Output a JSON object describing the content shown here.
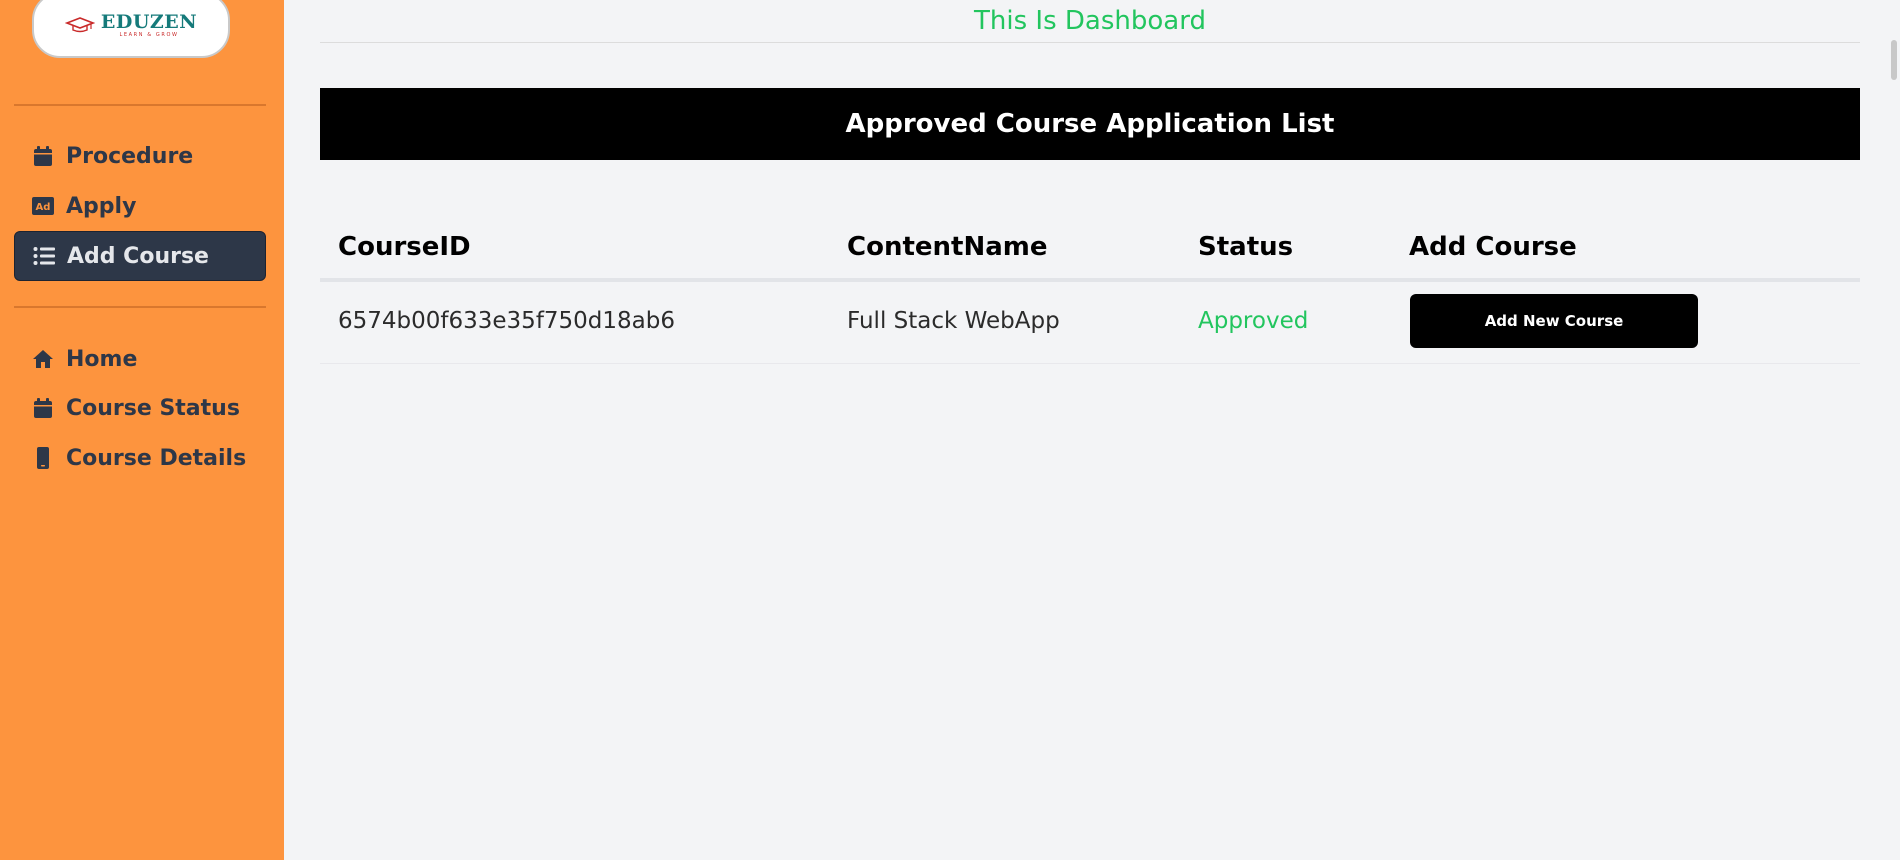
{
  "brand": {
    "name": "EDUZEN",
    "tagline": "LEARN & GROW"
  },
  "sidebar": {
    "items_top": [
      {
        "label": "Procedure",
        "icon": "calendar-icon",
        "active": false
      },
      {
        "label": "Apply",
        "icon": "ad-icon",
        "active": false
      },
      {
        "label": "Add Course",
        "icon": "list-icon",
        "active": true
      }
    ],
    "items_bottom": [
      {
        "label": "Home",
        "icon": "home-icon",
        "active": false
      },
      {
        "label": "Course Status",
        "icon": "calendar-icon",
        "active": false
      },
      {
        "label": "Course Details",
        "icon": "mobile-icon",
        "active": false
      }
    ]
  },
  "main": {
    "page_title": "This Is Dashboard",
    "banner_title": "Approved Course Application List",
    "table": {
      "headers": [
        "CourseID",
        "ContentName",
        "Status",
        "Add Course"
      ],
      "rows": [
        {
          "course_id": "6574b00f633e35f750d18ab6",
          "content_name": "Full Stack WebApp",
          "status": "Approved",
          "action_label": "Add New Course"
        }
      ]
    }
  },
  "colors": {
    "sidebar_bg": "#fd943e",
    "active_item_bg": "#2d3748",
    "accent_green": "#22c55e",
    "banner_bg": "#000000",
    "page_bg": "#f3f4f6"
  }
}
